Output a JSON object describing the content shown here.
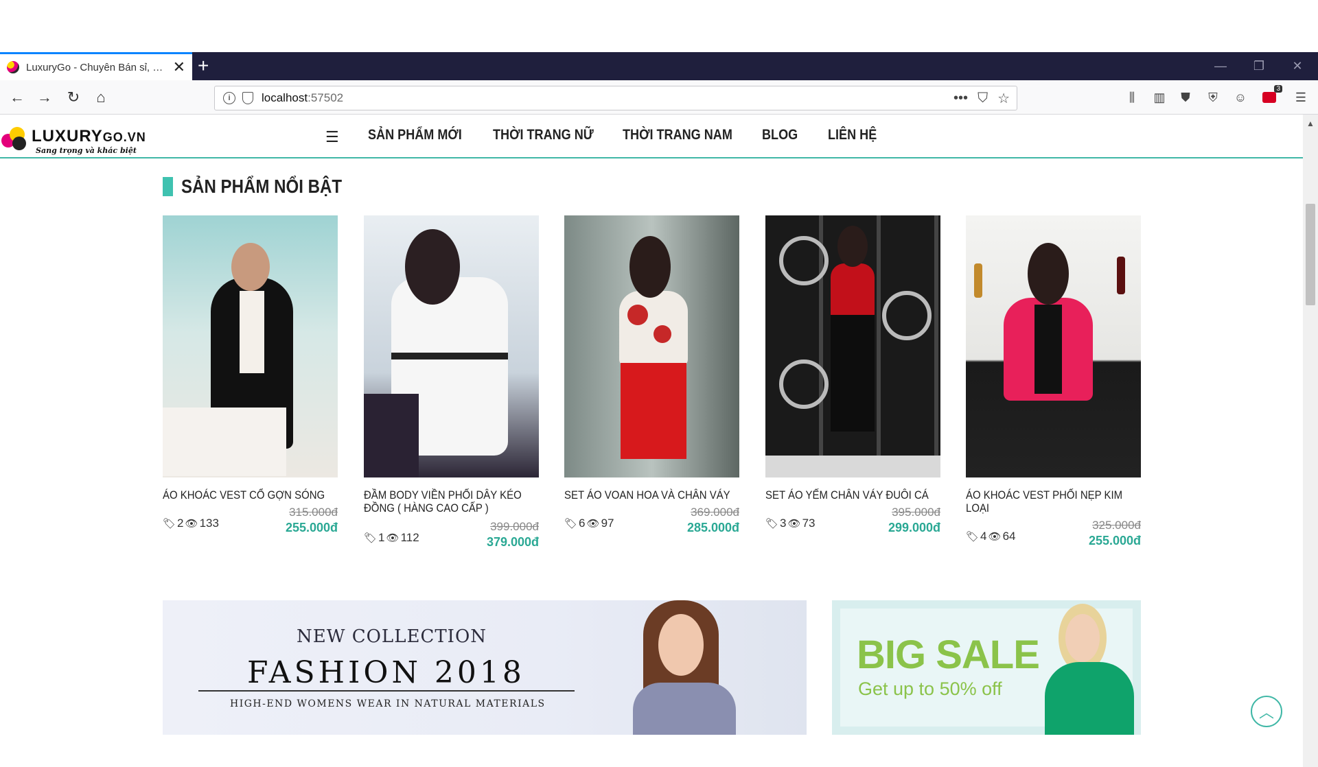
{
  "browser": {
    "tab_title": "LuxuryGo - Chuyên Bán sỉ, Bán lẻ",
    "url_host": "localhost",
    "url_port": ":57502",
    "new_tab_label": "+",
    "menu_badge": "3"
  },
  "site": {
    "logo_brand": "LUXURY",
    "logo_suffix": "GO.VN",
    "logo_slogan": "Sang trọng và khác biệt",
    "menu": [
      "SẢN PHẨM MỚI",
      "THỜI TRANG NỮ",
      "THỜI TRANG NAM",
      "BLOG",
      "LIÊN HỆ"
    ],
    "accent_color": "#3fb7a6",
    "price_color": "#2aa894"
  },
  "section": {
    "title": "SẢN PHẨM NỔI BẬT"
  },
  "products": [
    {
      "name": "ÁO KHOÁC VEST CỔ GỢN SÓNG",
      "tags": "2",
      "views": "133",
      "old_price": "315.000đ",
      "price": "255.000đ"
    },
    {
      "name": "ĐẦM BODY VIỀN PHỐI DÂY KÉO ĐỒNG ( HÀNG CAO CẤP )",
      "tags": "1",
      "views": "112",
      "old_price": "399.000đ",
      "price": "379.000đ"
    },
    {
      "name": "SET ÁO VOAN HOA VÀ CHÂN VÁY",
      "tags": "6",
      "views": "97",
      "old_price": "369.000đ",
      "price": "285.000đ"
    },
    {
      "name": "SET ÁO YẾM CHÂN VÁY ĐUÔI CÁ",
      "tags": "3",
      "views": "73",
      "old_price": "395.000đ",
      "price": "299.000đ"
    },
    {
      "name": "ÁO KHOÁC VEST PHỐI NẸP KIM LOẠI",
      "tags": "4",
      "views": "64",
      "old_price": "325.000đ",
      "price": "255.000đ"
    }
  ],
  "banners": {
    "left_line1": "NEW COLLECTION",
    "left_line2": "FASHION 2018",
    "left_line3": "HIGH-END WOMENS WEAR IN NATURAL MATERIALS",
    "right_line1": "BIG SALE",
    "right_line2": "Get up to 50% off"
  }
}
